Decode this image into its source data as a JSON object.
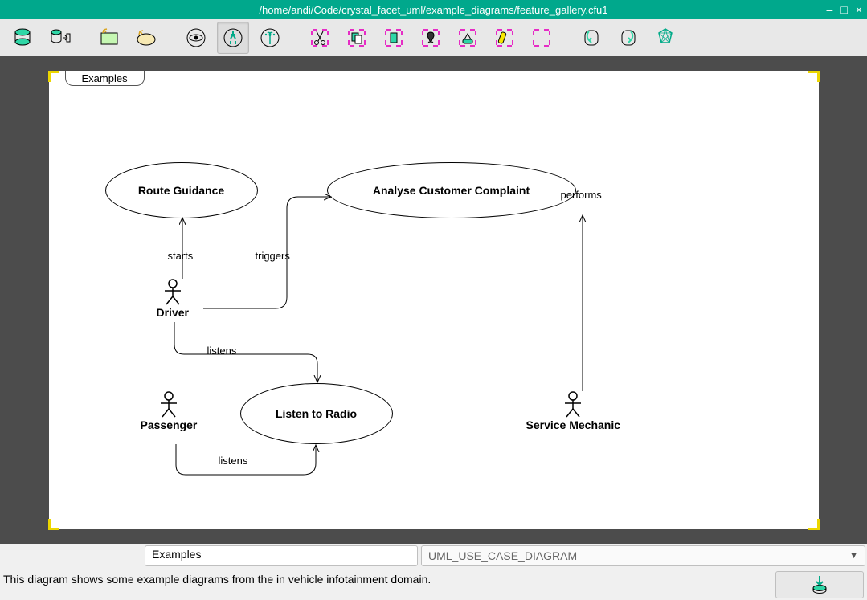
{
  "window": {
    "title": "/home/andi/Code/crystal_facet_uml/example_diagrams/feature_gallery.cfu1"
  },
  "toolbar": {
    "tools": [
      "database-icon",
      "export-icon",
      "new-window-icon",
      "new-view-icon",
      "view-icon",
      "edit-icon",
      "create-icon",
      "cut-icon",
      "copy-icon",
      "paste-icon",
      "delete-icon",
      "instance-icon",
      "highlight-icon",
      "reset-icon",
      "undo-icon",
      "redo-icon",
      "about-icon"
    ],
    "selected_tool": "edit-icon"
  },
  "diagram": {
    "tab_label": "Examples",
    "usecases": {
      "route_guidance": "Route Guidance",
      "analyse_complaint": "Analyse Customer Complaint",
      "listen_radio": "Listen to Radio"
    },
    "actors": {
      "driver": "Driver",
      "passenger": "Passenger",
      "mechanic": "Service Mechanic"
    },
    "edges": {
      "starts": "starts",
      "triggers": "triggers",
      "performs": "performs",
      "listens1": "listens",
      "listens2": "listens"
    }
  },
  "bottom": {
    "name_field": "Examples",
    "type_field": "UML_USE_CASE_DIAGRAM",
    "description": "This diagram shows some example diagrams from the in vehicle infotainment domain."
  }
}
